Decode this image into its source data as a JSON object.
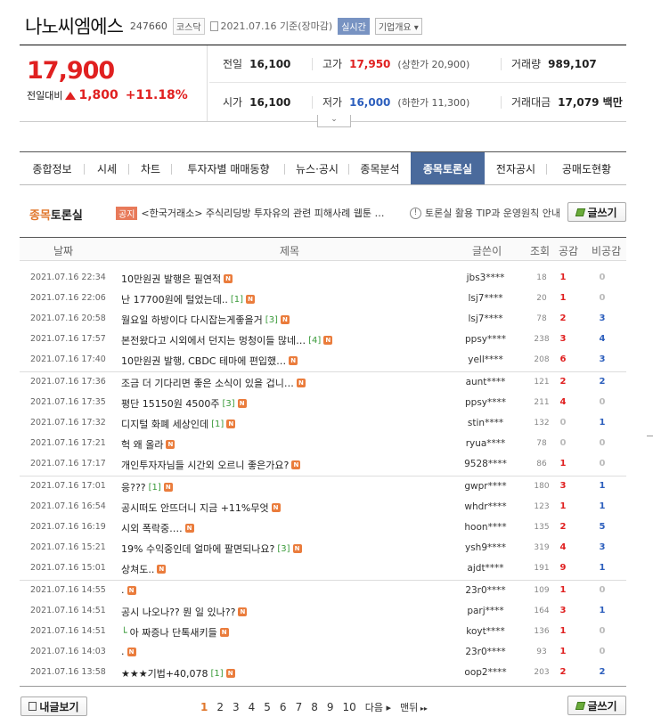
{
  "header": {
    "name": "나노씨엠에스",
    "code": "247660",
    "market": "코스닥",
    "date": "2021.07.16 기준(장마감)",
    "realtime": "실시간",
    "company_info": "기업개요"
  },
  "price": {
    "current": "17,900",
    "label": "전일대비",
    "change": "1,800",
    "percent": "+11.18%",
    "arrow": "up-triangle-icon"
  },
  "stats": {
    "prev_close": {
      "label": "전일",
      "value": "16,100"
    },
    "high": {
      "label": "고가",
      "value": "17,950",
      "sub": "(상한가 20,900)"
    },
    "volume": {
      "label": "거래량",
      "value": "989,107"
    },
    "open": {
      "label": "시가",
      "value": "16,100"
    },
    "low": {
      "label": "저가",
      "value": "16,000",
      "sub": "(하한가 11,300)"
    },
    "amount": {
      "label": "거래대금",
      "value": "17,079 백만"
    }
  },
  "tabs": [
    "종합정보",
    "시세",
    "차트",
    "투자자별 매매동향",
    "뉴스·공시",
    "종목분석",
    "종목토론실",
    "전자공시",
    "공매도현황"
  ],
  "active_tab": "종목토론실",
  "board": {
    "title_a": "종목",
    "title_b": "토론실",
    "notice_badge": "공지",
    "notice_text": "<한국거래소> 주식리딩방 투자유의 관련 피해사례 웹툰 …",
    "tip_text": "토론실 활용 TIP과 운영원칙 안내",
    "write_label": "글쓰기"
  },
  "columns": [
    "날짜",
    "제목",
    "글쓴이",
    "조회",
    "공감",
    "비공감"
  ],
  "rows": [
    {
      "date": "2021.07.16 22:34",
      "title": "10만원권 발행은 필연적",
      "comments": "",
      "writer": "jbs3****",
      "views": "18",
      "likes": "1",
      "dislikes": "0"
    },
    {
      "date": "2021.07.16 22:06",
      "title": "난 17700원에 털었는데..",
      "comments": "[1]",
      "writer": "lsj7****",
      "views": "20",
      "likes": "1",
      "dislikes": "0"
    },
    {
      "date": "2021.07.16 20:58",
      "title": "월요일 하방이다 다시잡는게좋을거",
      "comments": "[3]",
      "writer": "lsj7****",
      "views": "78",
      "likes": "2",
      "dislikes": "3"
    },
    {
      "date": "2021.07.16 17:57",
      "title": "본전왔다고 시외에서 던지는 멍청이들 많네…",
      "comments": "[4]",
      "writer": "ppsy****",
      "views": "238",
      "likes": "3",
      "dislikes": "4"
    },
    {
      "date": "2021.07.16 17:40",
      "title": "10만원권 발행, CBDC 테마에 편입했…",
      "comments": "",
      "writer": "yell****",
      "views": "208",
      "likes": "6",
      "dislikes": "3"
    },
    {
      "date": "2021.07.16 17:36",
      "title": "조금 더 기다리면 좋은 소식이 있을 겁니…",
      "comments": "",
      "writer": "aunt****",
      "views": "121",
      "likes": "2",
      "dislikes": "2"
    },
    {
      "date": "2021.07.16 17:35",
      "title": "평단 15150원 4500주",
      "comments": "[3]",
      "writer": "ppsy****",
      "views": "211",
      "likes": "4",
      "dislikes": "0"
    },
    {
      "date": "2021.07.16 17:32",
      "title": "디지털 화폐 세상인데",
      "comments": "[1]",
      "writer": "stin****",
      "views": "132",
      "likes": "0",
      "dislikes": "1"
    },
    {
      "date": "2021.07.16 17:21",
      "title": "헉 왜 올라",
      "comments": "",
      "writer": "ryua****",
      "views": "78",
      "likes": "0",
      "dislikes": "0"
    },
    {
      "date": "2021.07.16 17:17",
      "title": "개인투자자님들 시간외 오르니 좋은가요?",
      "comments": "",
      "writer": "9528****",
      "views": "86",
      "likes": "1",
      "dislikes": "0"
    },
    {
      "date": "2021.07.16 17:01",
      "title": "응???",
      "comments": "[1]",
      "writer": "gwpr****",
      "views": "180",
      "likes": "3",
      "dislikes": "1"
    },
    {
      "date": "2021.07.16 16:54",
      "title": "공시떠도 안뜨더니 지금 +11%무엇",
      "comments": "",
      "writer": "whdr****",
      "views": "123",
      "likes": "1",
      "dislikes": "1"
    },
    {
      "date": "2021.07.16 16:19",
      "title": "시외 폭락중….",
      "comments": "",
      "writer": "hoon****",
      "views": "135",
      "likes": "2",
      "dislikes": "5"
    },
    {
      "date": "2021.07.16 15:21",
      "title": "19% 수익중인데 얼마에 팔면되나요?",
      "comments": "[3]",
      "writer": "ysh9****",
      "views": "319",
      "likes": "4",
      "dislikes": "3"
    },
    {
      "date": "2021.07.16 15:01",
      "title": "상쳐도..",
      "comments": "",
      "writer": "ajdt****",
      "views": "191",
      "likes": "9",
      "dislikes": "1"
    },
    {
      "date": "2021.07.16 14:55",
      "title": ".",
      "comments": "",
      "writer": "23r0****",
      "views": "109",
      "likes": "1",
      "dislikes": "0"
    },
    {
      "date": "2021.07.16 14:51",
      "title": "공시 나오나?? 뭔 일 있나??",
      "comments": "",
      "writer": "parj****",
      "views": "164",
      "likes": "3",
      "dislikes": "1"
    },
    {
      "date": "2021.07.16 14:51",
      "title": "아 짜증나 단톡새키들",
      "comments": "",
      "writer": "koyt****",
      "views": "136",
      "likes": "1",
      "dislikes": "0",
      "reply": true
    },
    {
      "date": "2021.07.16 14:03",
      "title": ".",
      "comments": "",
      "writer": "23r0****",
      "views": "93",
      "likes": "1",
      "dislikes": "0"
    },
    {
      "date": "2021.07.16 13:58",
      "title": "★★★기법+40,078",
      "comments": "[1]",
      "writer": "oop2****",
      "views": "203",
      "likes": "2",
      "dislikes": "2"
    }
  ],
  "footer": {
    "my_posts": "내글보기",
    "pages": [
      "1",
      "2",
      "3",
      "4",
      "5",
      "6",
      "7",
      "8",
      "9",
      "10"
    ],
    "next": "다음",
    "last": "맨뒤",
    "write_label": "글쓰기"
  },
  "colors": {
    "up": "#e02020",
    "down": "#2d5fbd",
    "active_tab": "#4a6a9c",
    "new_badge": "#ea7c3c"
  }
}
